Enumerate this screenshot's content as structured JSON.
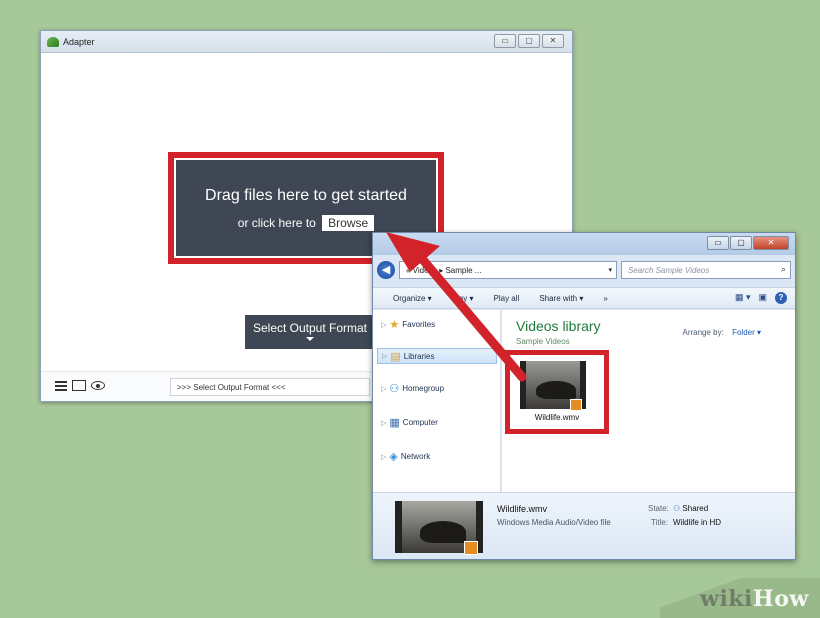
{
  "adapter": {
    "title": "Adapter",
    "window_buttons": [
      "▭",
      "▢",
      "✕"
    ],
    "drop_zone": {
      "title": "Drag files here to get started",
      "subtitle": "or click here to",
      "browse_label": "Browse"
    },
    "output_format_button": "Select Output Format",
    "status_text": ">>> Select Output Format <<<"
  },
  "explorer": {
    "window_buttons": [
      "▭",
      "▢",
      "✕"
    ],
    "address": "« Videos ▸ Sample ...",
    "search_placeholder": "Search Sample Videos",
    "toolbar": {
      "organize": "Organize ▾",
      "play": "Play ▾",
      "play_all": "Play all",
      "share_with": "Share with ▾",
      "more": "»"
    },
    "nav": [
      {
        "label": "Favorites",
        "glyph": "★"
      },
      {
        "label": "Libraries",
        "glyph": "▤"
      },
      {
        "label": "Homegroup",
        "glyph": "⚇"
      },
      {
        "label": "Computer",
        "glyph": "▦"
      },
      {
        "label": "Network",
        "glyph": "◈"
      }
    ],
    "library_title": "Videos library",
    "library_sub": "Sample Videos",
    "arrange_label": "Arrange by:",
    "arrange_value": "Folder ▾",
    "file_name": "Wildlife.wmv",
    "details": {
      "name": "Wildlife.wmv",
      "type": "Windows Media Audio/Video file",
      "state_label": "State:",
      "state_value": "Shared",
      "title_label": "Title:",
      "title_value": "Wildlife in HD"
    }
  },
  "watermark": {
    "wiki": "wiki",
    "how": "How"
  },
  "colors": {
    "highlight_red": "#d2232a",
    "drop_zone_bg": "#3e4753",
    "background": "#a7c898"
  }
}
